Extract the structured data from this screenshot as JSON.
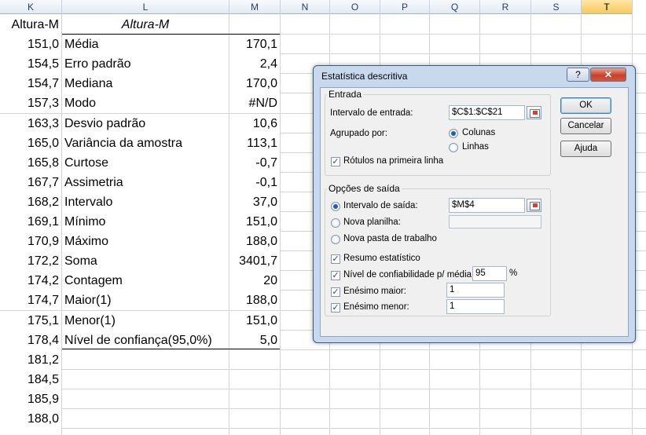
{
  "columns": [
    {
      "label": "K"
    },
    {
      "label": "L"
    },
    {
      "label": "M"
    },
    {
      "label": "N"
    },
    {
      "label": "O"
    },
    {
      "label": "P"
    },
    {
      "label": "Q"
    },
    {
      "label": "R"
    },
    {
      "label": "S"
    },
    {
      "label": "T"
    }
  ],
  "sheet": {
    "header_k": "Altura-M",
    "header_l": "Altura-M",
    "col_k": [
      "151,0",
      "154,5",
      "154,7",
      "157,3",
      "163,3",
      "165,0",
      "165,8",
      "167,7",
      "168,2",
      "169,1",
      "170,9",
      "172,2",
      "174,2",
      "174,7",
      "175,1",
      "178,4",
      "181,2",
      "184,5",
      "185,9",
      "188,0"
    ],
    "stats": [
      {
        "label": "Média",
        "value": "170,1"
      },
      {
        "label": "Erro padrão",
        "value": "2,4"
      },
      {
        "label": "Mediana",
        "value": "170,0"
      },
      {
        "label": "Modo",
        "value": "#N/D"
      },
      {
        "label": "Desvio padrão",
        "value": "10,6"
      },
      {
        "label": "Variância da amostra",
        "value": "113,1"
      },
      {
        "label": "Curtose",
        "value": "-0,7"
      },
      {
        "label": "Assimetria",
        "value": "-0,1"
      },
      {
        "label": "Intervalo",
        "value": "37,0"
      },
      {
        "label": "Mínimo",
        "value": "151,0"
      },
      {
        "label": "Máximo",
        "value": "188,0"
      },
      {
        "label": "Soma",
        "value": "3401,7"
      },
      {
        "label": "Contagem",
        "value": "20"
      },
      {
        "label": "Maior(1)",
        "value": "188,0"
      },
      {
        "label": "Menor(1)",
        "value": "151,0"
      },
      {
        "label": "Nível de confiança(95,0%)",
        "value": "5,0"
      }
    ]
  },
  "dialog": {
    "title": "Estatística descritiva",
    "help_label": "?",
    "close_label": "✕",
    "entrada": {
      "group_label": "Entrada",
      "input_range_label": "Intervalo de entrada:",
      "input_range_value": "$C$1:$C$21",
      "grouped_by_label": "Agrupado por:",
      "columns_label": "Colunas",
      "rows_label": "Linhas",
      "labels_first_row": "Rótulos na primeira linha"
    },
    "saida": {
      "group_label": "Opções de saída",
      "output_range_label": "Intervalo de saída:",
      "output_range_value": "$M$4",
      "new_sheet_label": "Nova planilha:",
      "new_sheet_value": "",
      "new_workbook_label": "Nova pasta de trabalho",
      "summary_label": "Resumo estatístico",
      "confidence_label": "Nível de confiabilidade p/ média:",
      "confidence_value": "95",
      "percent": "%",
      "kth_largest_label": "Enésimo maior:",
      "kth_largest_value": "1",
      "kth_smallest_label": "Enésimo menor:",
      "kth_smallest_value": "1"
    },
    "buttons": {
      "ok": "OK",
      "cancel": "Cancelar",
      "help": "Ajuda"
    }
  }
}
